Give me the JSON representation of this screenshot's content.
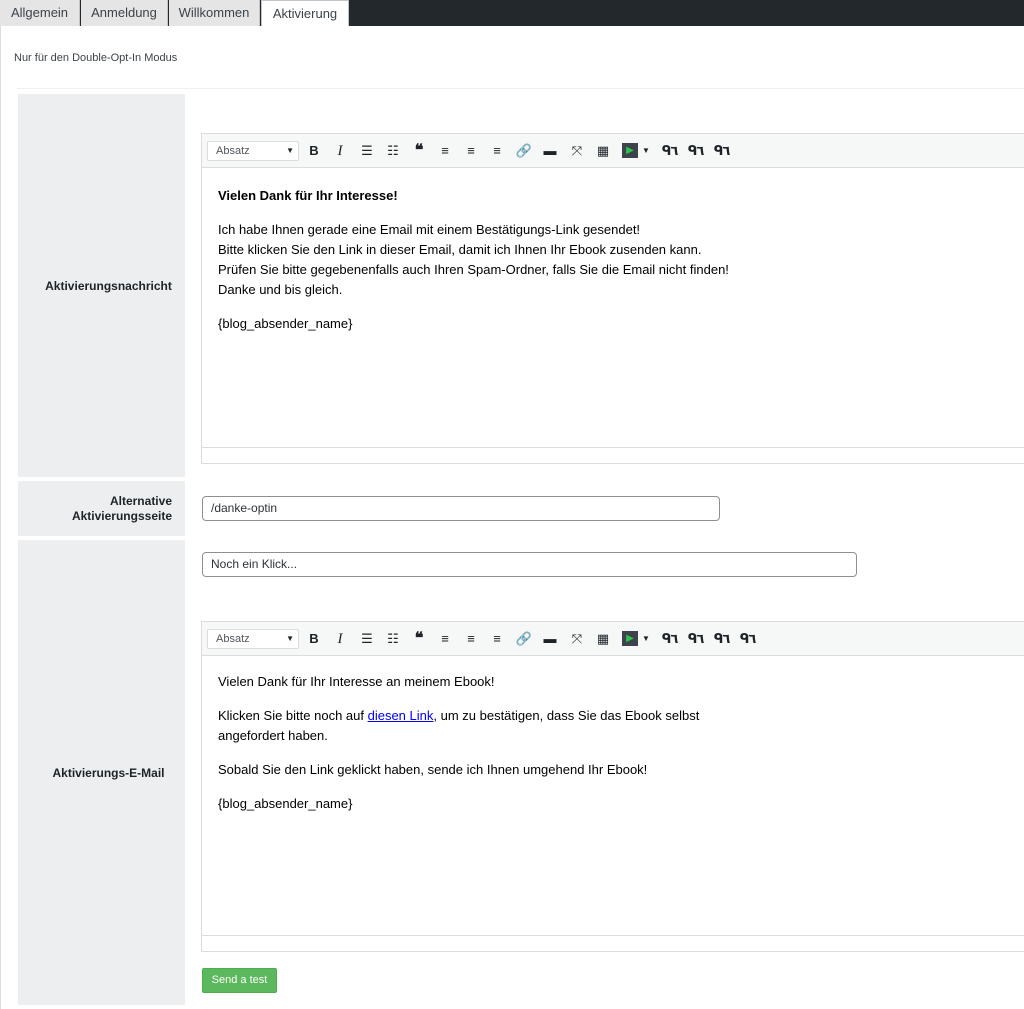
{
  "tabs": [
    "Allgemein",
    "Anmeldung",
    "Willkommen",
    "Aktivierung"
  ],
  "intro_text": "Nur für den Double-Opt-In Modus",
  "rows": {
    "message_label": "Aktivierungsnachricht",
    "alt_page_label": "Alternative Aktivierungsseite",
    "email_label": "Aktivierungs-E-Mail"
  },
  "editor1": {
    "format_select": "Absatz",
    "heading": "Vielen Dank für Ihr Interesse!",
    "lines": [
      "Ich habe Ihnen gerade eine Email mit einem Bestätigungs-Link gesendet!",
      "Bitte klicken Sie den Link in dieser Email, damit ich Ihnen Ihr Ebook zusenden kann.",
      "Prüfen Sie bitte gegebenenfalls auch Ihren Spam-Ordner, falls Sie die Email nicht finden!",
      "Danke und bis gleich."
    ],
    "signature": "{blog_absender_name}"
  },
  "alt_page_input": "/danke-optin",
  "subject_input": "Noch ein Klick...",
  "editor2": {
    "format_select": "Absatz",
    "p1": "Vielen Dank für Ihr Interesse an meinem Ebook!",
    "p2_before": "Klicken Sie bitte noch auf ",
    "p2_link": "diesen Link",
    "p2_after": ", um zu bestätigen, dass Sie das Ebook selbst",
    "p2_line2": "angefordert haben.",
    "p3": "Sobald Sie den Link geklickt haben, sende ich Ihnen umgehend Ihr Ebook!",
    "signature": "{blog_absender_name}"
  },
  "send_test_label": "Send a test",
  "colors": {
    "tabbar": "#23282d",
    "label_bg": "#eceeef",
    "button_green": "#5cb85c",
    "link_blue": "#0000ee"
  },
  "toolbar_icons": [
    "bold-icon",
    "italic-icon",
    "bullet-list-icon",
    "numbered-list-icon",
    "blockquote-icon",
    "align-left-icon",
    "align-center-icon",
    "align-right-icon",
    "link-icon",
    "read-more-icon",
    "fullscreen-icon",
    "keyboard-icon",
    "media-play-icon",
    "dropdown-icon",
    "shortcode-icon"
  ]
}
